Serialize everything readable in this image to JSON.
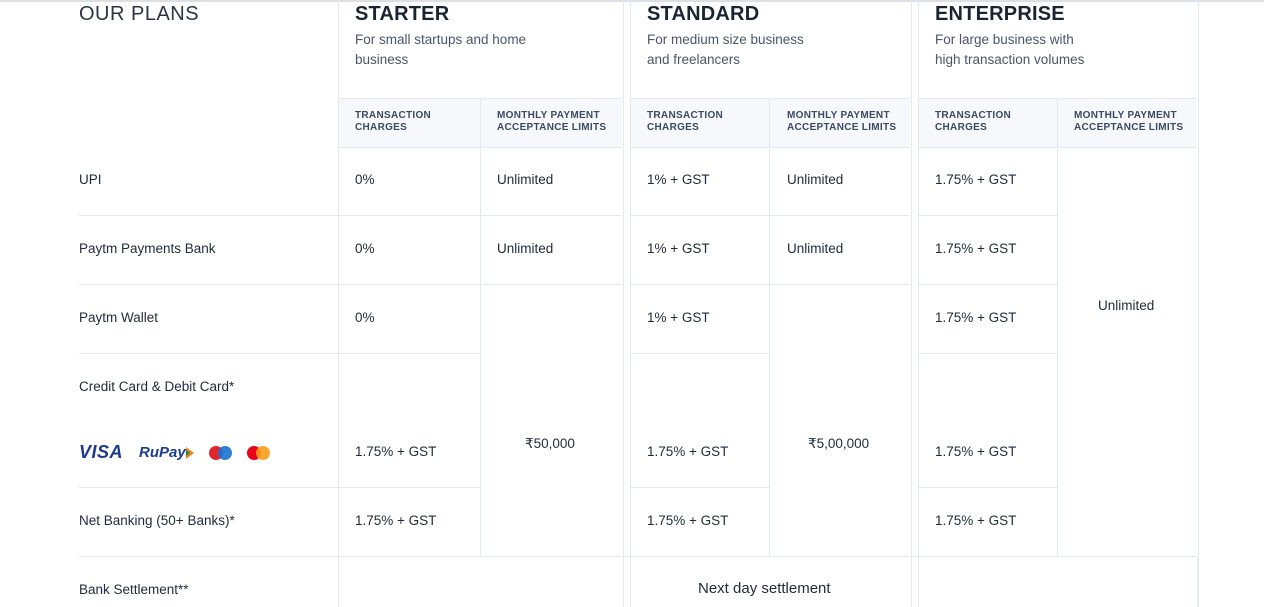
{
  "section_title": "OUR PLANS",
  "plans": {
    "starter": {
      "name": "STARTER",
      "desc_line1": "For small startups and home",
      "desc_line2": "business"
    },
    "standard": {
      "name": "STANDARD",
      "desc_line1": "For medium size business",
      "desc_line2": "and freelancers"
    },
    "enterprise": {
      "name": "ENTERPRISE",
      "desc_line1": "For large business with",
      "desc_line2": "high transaction volumes"
    }
  },
  "column_headers": {
    "charges_line1": "TRANSACTION",
    "charges_line2": "CHARGES",
    "limits_line1": "MONTHLY PAYMENT",
    "limits_line2": "ACCEPTANCE LIMITS"
  },
  "rows": {
    "upi": "UPI",
    "ppb": "Paytm Payments Bank",
    "wallet": "Paytm Wallet",
    "cards": "Credit Card & Debit Card*",
    "netbanking": "Net Banking (50+ Banks)*",
    "settlement": "Bank Settlement**"
  },
  "card_logos": {
    "visa": "VISA",
    "rupay": "RuPay",
    "maestro_colors": [
      "#e3262e",
      "#1a73d0"
    ],
    "mastercard_colors": [
      "#eb001b",
      "#f79e1b"
    ]
  },
  "values": {
    "zero": "0%",
    "unlimited": "Unlimited",
    "one_gst": "1% + GST",
    "one75_gst": "1.75% + GST",
    "starter_limit": "₹50,000",
    "standard_limit": "₹5,00,000",
    "enterprise_limit": "Unlimited",
    "settlement": "Next day settlement"
  }
}
